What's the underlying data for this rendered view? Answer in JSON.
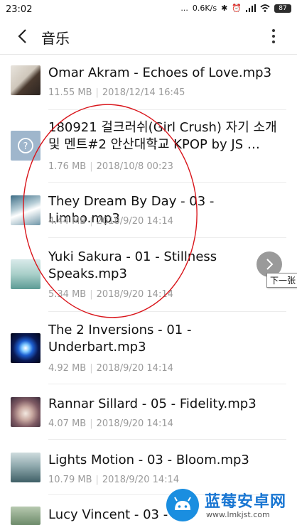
{
  "status_bar": {
    "time": "23:02",
    "dots": "...",
    "speed": "0.6K/s",
    "battery": "87"
  },
  "header": {
    "title": "音乐"
  },
  "songs": [
    {
      "name": "Omar Akram - Echoes of Love.mp3",
      "size": "11.55 MB",
      "date": "2018/12/14 16:45",
      "thumb": "photo"
    },
    {
      "name": "180921 걸크러쉬(Girl Crush) 자기 소개 및 멘트#2 안산대학교 KPOP by JS …",
      "size": "1.76 MB",
      "date": "2018/10/8 00:23",
      "thumb": "unknown"
    },
    {
      "name": "They Dream By Day - 03 - Limbo.mp3",
      "size": "4.44 MB",
      "date": "2018/9/20 14:14",
      "thumb": "photo"
    },
    {
      "name": "Yuki Sakura - 01 - Stillness Speaks.mp3",
      "size": "5.34 MB",
      "date": "2018/9/20 14:14",
      "thumb": "photo"
    },
    {
      "name": "The 2 Inversions - 01 - Underbart.mp3",
      "size": "4.92 MB",
      "date": "2018/9/20 14:14",
      "thumb": "photo"
    },
    {
      "name": "Rannar Sillard - 05 - Fidelity.mp3",
      "size": "4.07 MB",
      "date": "2018/9/20 14:14",
      "thumb": "photo"
    },
    {
      "name": "Lights Motion - 03 - Bloom.mp3",
      "size": "10.79 MB",
      "date": "2018/9/20 14:14",
      "thumb": "photo"
    },
    {
      "name": "Lucy Vincent - 03 -",
      "size": "",
      "date": "",
      "thumb": "photo"
    }
  ],
  "overlay": {
    "next_label": "下一张"
  },
  "watermark": {
    "title": "蓝莓安卓网",
    "url": "www.lmkjst.com"
  },
  "colors": {
    "annotation": "#d9151b",
    "accent": "#1976d2"
  }
}
